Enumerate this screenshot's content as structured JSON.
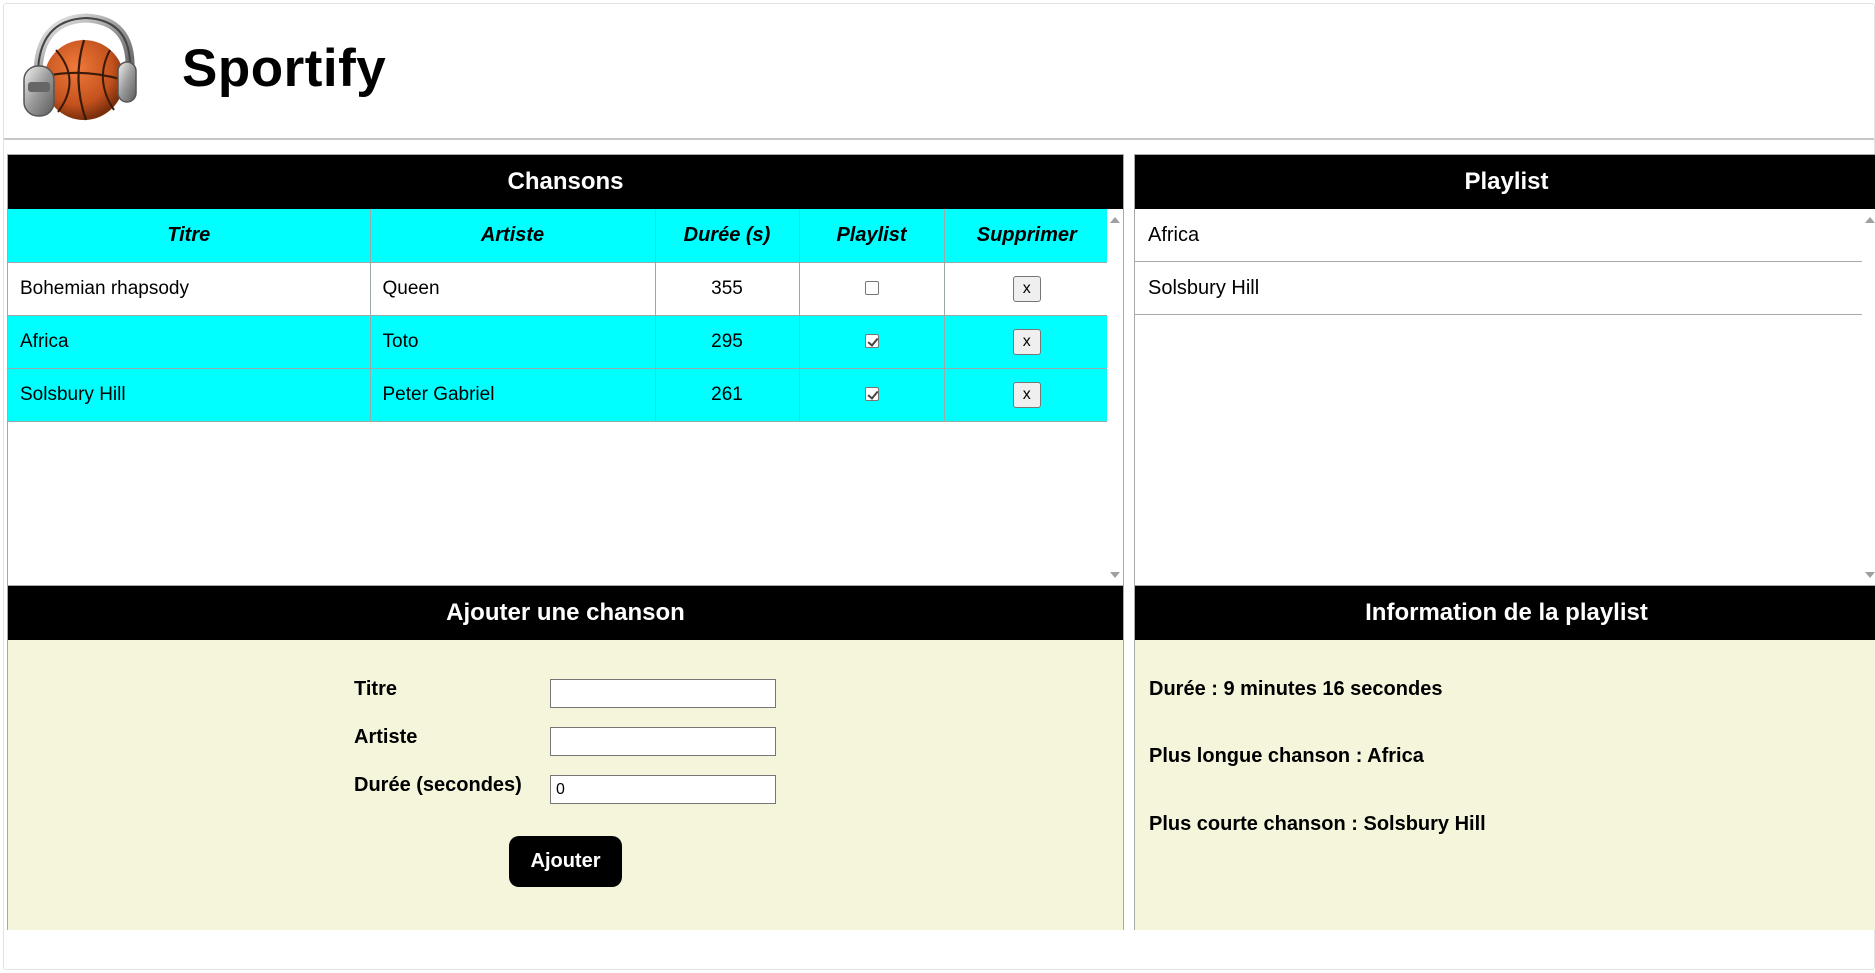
{
  "app": {
    "title": "Sportify"
  },
  "songs": {
    "heading": "Chansons",
    "columns": [
      "Titre",
      "Artiste",
      "Durée (s)",
      "Playlist",
      "Supprimer"
    ],
    "rows": [
      {
        "title": "Bohemian rhapsody",
        "artist": "Queen",
        "duration": "355",
        "in_playlist": false,
        "delete_label": "x"
      },
      {
        "title": "Africa",
        "artist": "Toto",
        "duration": "295",
        "in_playlist": true,
        "delete_label": "x"
      },
      {
        "title": "Solsbury Hill",
        "artist": "Peter Gabriel",
        "duration": "261",
        "in_playlist": true,
        "delete_label": "x"
      }
    ]
  },
  "playlist": {
    "heading": "Playlist",
    "items": [
      "Africa",
      "Solsbury Hill"
    ]
  },
  "add_form": {
    "heading": "Ajouter une chanson",
    "title_label": "Titre",
    "title_value": "",
    "artist_label": "Artiste",
    "artist_value": "",
    "duration_label": "Durée (secondes)",
    "duration_value": "0",
    "submit_label": "Ajouter"
  },
  "info": {
    "heading": "Information de la playlist",
    "duration": "Durée : 9 minutes 16 secondes",
    "longest": "Plus longue chanson : Africa",
    "shortest": "Plus courte chanson : Solsbury Hill"
  },
  "colors": {
    "header_bg": "#000000",
    "row_highlight": "#00ffff",
    "form_bg": "#f5f5dc"
  }
}
